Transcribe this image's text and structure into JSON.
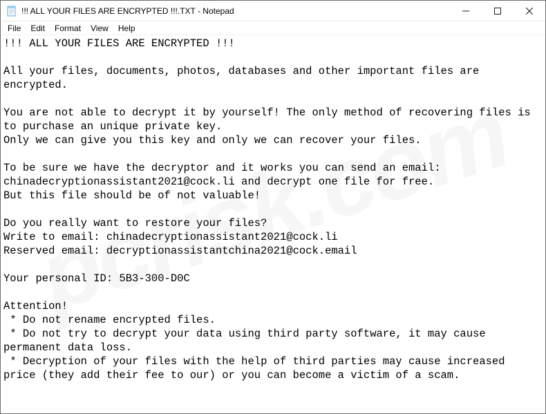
{
  "titlebar": {
    "title": "!!! ALL YOUR FILES ARE ENCRYPTED !!!.TXT - Notepad"
  },
  "menubar": {
    "file": "File",
    "edit": "Edit",
    "format": "Format",
    "view": "View",
    "help": "Help"
  },
  "document": {
    "line1": "!!! ALL YOUR FILES ARE ENCRYPTED !!!",
    "blank1": "",
    "line2": "All your files, documents, photos, databases and other important files are encrypted.",
    "blank2": "",
    "line3": "You are not able to decrypt it by yourself! The only method of recovering files is to purchase an unique private key.",
    "line4": "Only we can give you this key and only we can recover your files.",
    "blank3": "",
    "line5": "To be sure we have the decryptor and it works you can send an email:",
    "line6": "chinadecryptionassistant2021@cock.li and decrypt one file for free.",
    "line7": "But this file should be of not valuable!",
    "blank4": "",
    "line8": "Do you really want to restore your files?",
    "line9": "Write to email: chinadecryptionassistant2021@cock.li",
    "line10": "Reserved email: decryptionassistantchina2021@cock.email",
    "blank5": "",
    "line11": "Your personal ID: 5B3-300-D0C",
    "blank6": "",
    "line12": "Attention!",
    "line13": " * Do not rename encrypted files.",
    "line14": " * Do not try to decrypt your data using third party software, it may cause permanent data loss.",
    "line15": " * Decryption of your files with the help of third parties may cause increased price (they add their fee to our) or you can become a victim of a scam."
  },
  "watermark": "pcrisk.com"
}
